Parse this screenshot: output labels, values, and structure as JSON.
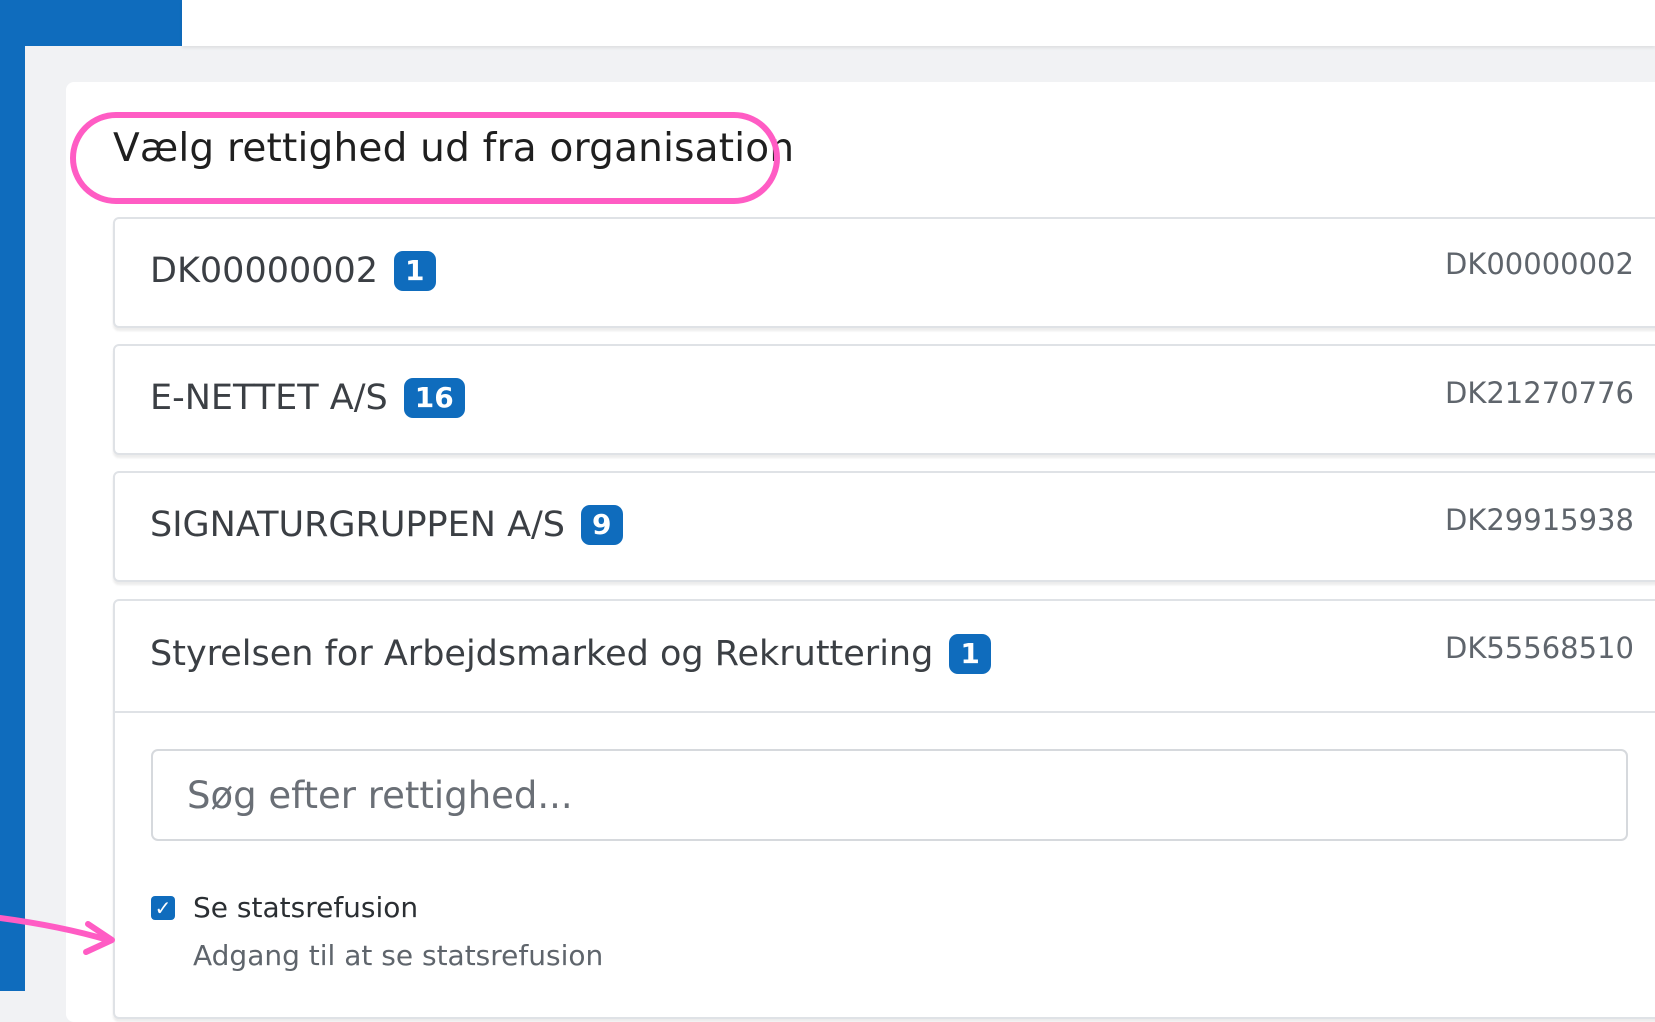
{
  "page": {
    "heading": "Vælg rettighed ud fra organisation"
  },
  "organizations": [
    {
      "name": "DK00000002",
      "count": "1",
      "cvr": "DK00000002"
    },
    {
      "name": "E-NETTET A/S",
      "count": "16",
      "cvr": "DK21270776"
    },
    {
      "name": "SIGNATURGRUPPEN A/S",
      "count": "9",
      "cvr": "DK29915938"
    },
    {
      "name": "Styrelsen for Arbejdsmarked og Rekruttering",
      "count": "1",
      "cvr": "DK55568510"
    }
  ],
  "expanded": {
    "search_placeholder": "Søg efter rettighed...",
    "permission_label": "Se statsrefusion",
    "permission_checked": true,
    "permission_description": "Adgang til at se statsrefusion"
  },
  "colors": {
    "brand": "#0f6cbd",
    "annotation": "#ff5cc4"
  }
}
